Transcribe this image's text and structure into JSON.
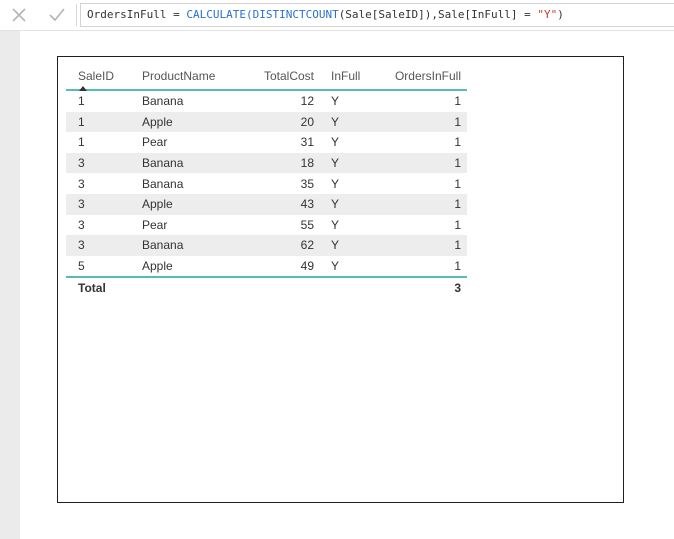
{
  "formula_bar": {
    "cancel_icon": "close-icon",
    "commit_icon": "checkmark-icon",
    "measure_name": "OrdersInFull",
    "equals": " = ",
    "func_calculate": "CALCULATE(",
    "func_distinctcount": "DISTINCTCOUNT",
    "arg1": "(Sale[SaleID]),Sale[InFull] = ",
    "string_value": "\"Y\"",
    "close_paren": ")"
  },
  "table": {
    "columns": [
      "SaleID",
      "ProductName",
      "TotalCost",
      "InFull",
      "OrdersInFull"
    ],
    "sort_column": "SaleID",
    "rows": [
      [
        "1",
        "Banana",
        "12",
        "Y",
        "1"
      ],
      [
        "1",
        "Apple",
        "20",
        "Y",
        "1"
      ],
      [
        "1",
        "Pear",
        "31",
        "Y",
        "1"
      ],
      [
        "3",
        "Banana",
        "18",
        "Y",
        "1"
      ],
      [
        "3",
        "Banana",
        "35",
        "Y",
        "1"
      ],
      [
        "3",
        "Apple",
        "43",
        "Y",
        "1"
      ],
      [
        "3",
        "Pear",
        "55",
        "Y",
        "1"
      ],
      [
        "3",
        "Banana",
        "62",
        "Y",
        "1"
      ],
      [
        "5",
        "Apple",
        "49",
        "Y",
        "1"
      ]
    ],
    "total_label": "Total",
    "total_value": "3"
  },
  "colors": {
    "accent_line": "#56bdb6",
    "function_blue": "#2b6fd0",
    "string_red": "#c0392b",
    "stripe": "#ededed"
  }
}
